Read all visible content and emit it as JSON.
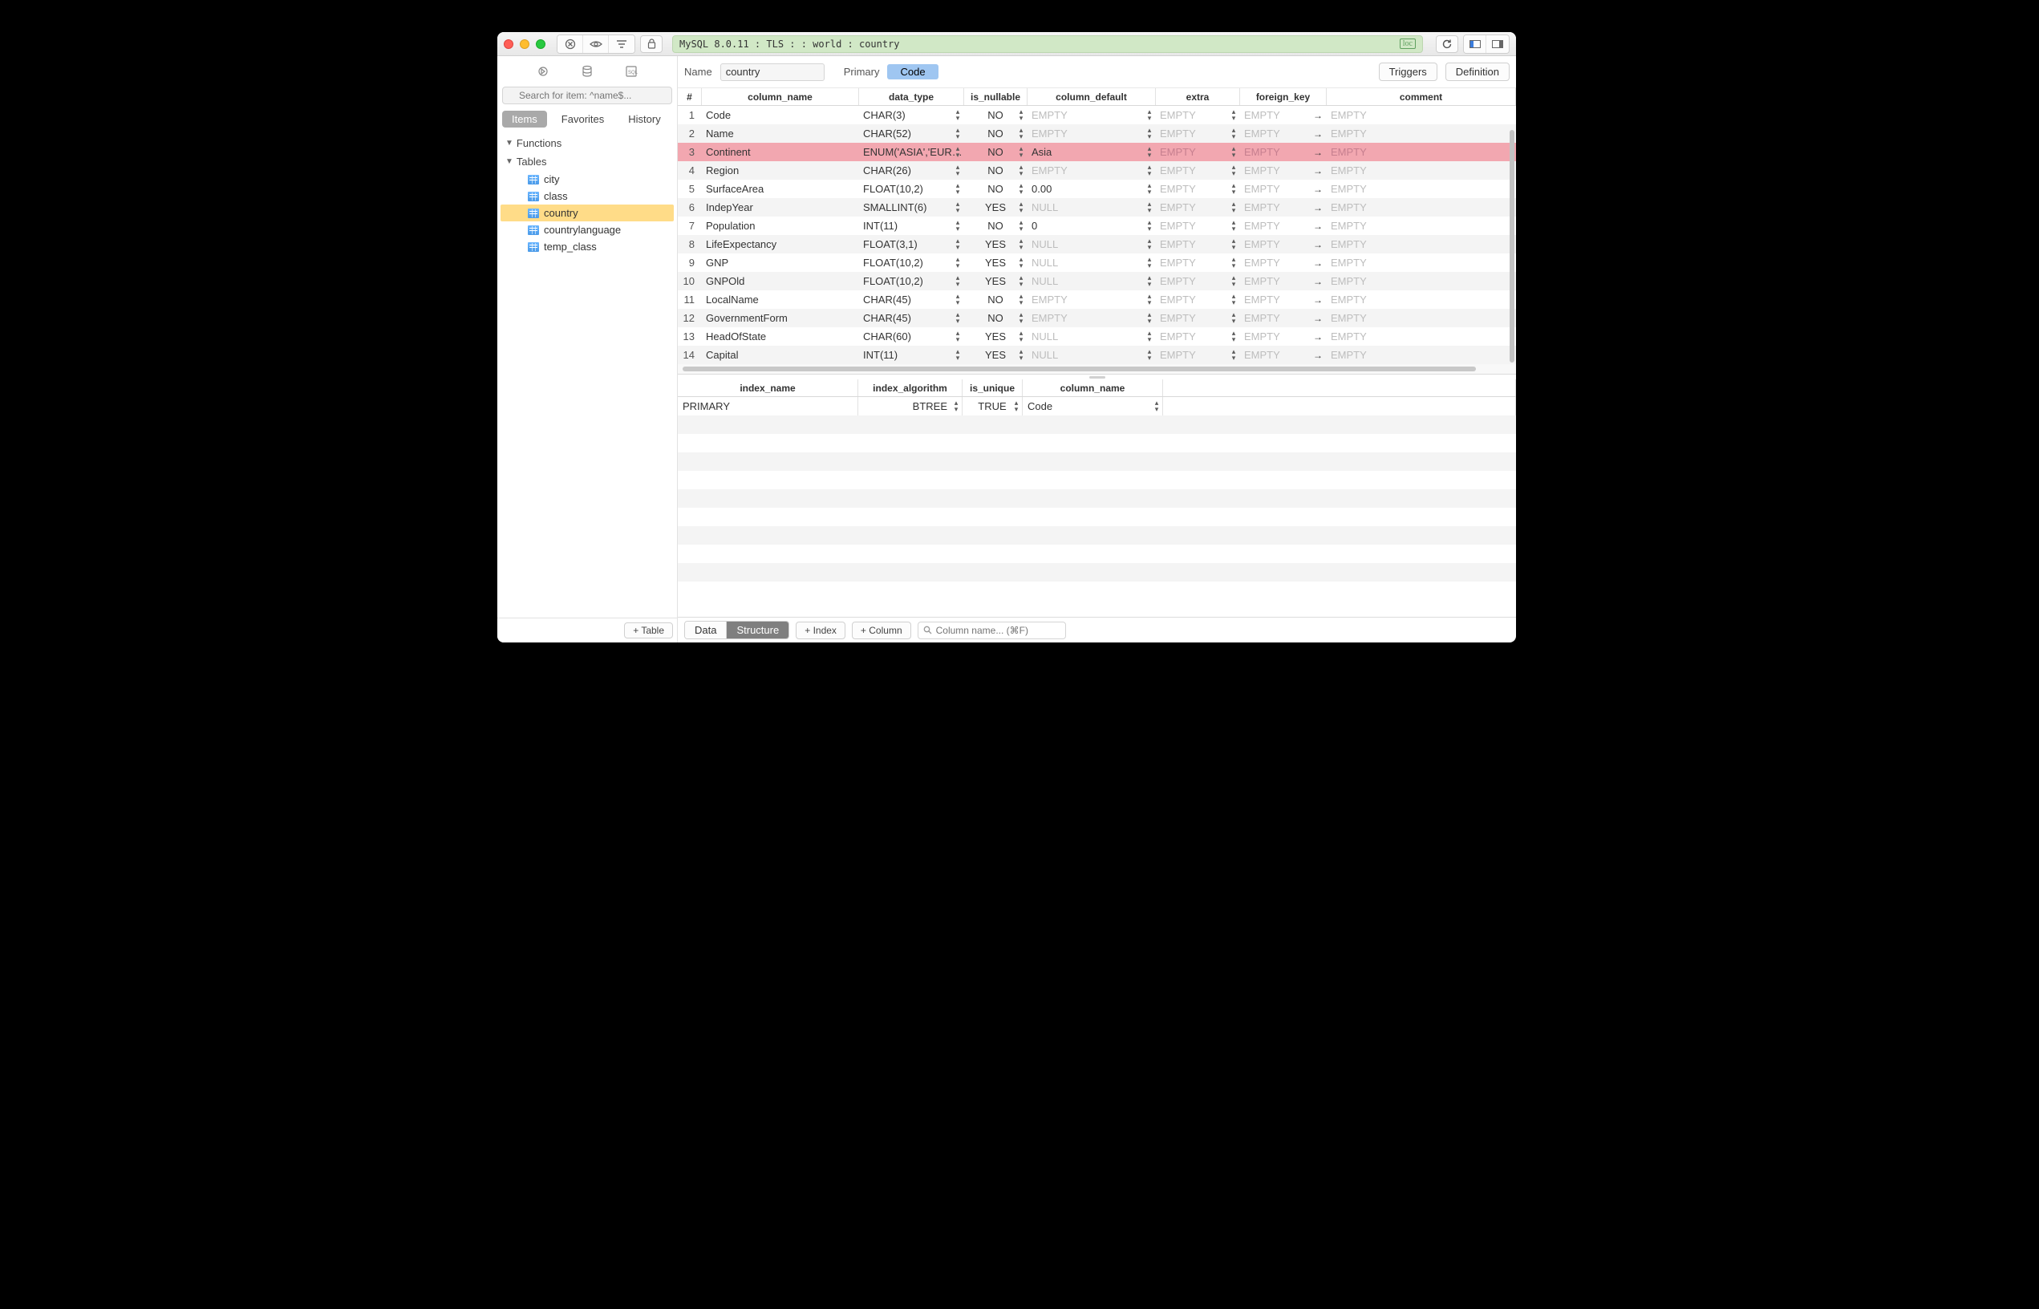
{
  "titlebar": {
    "connection_string": "MySQL 8.0.11 : TLS :  : world : country",
    "loc_badge": "loc"
  },
  "sidebar": {
    "search_placeholder": "Search for item: ^name$...",
    "tabs": [
      "Items",
      "Favorites",
      "History"
    ],
    "sections": [
      {
        "label": "Functions"
      },
      {
        "label": "Tables",
        "items": [
          "city",
          "class",
          "country",
          "countrylanguage",
          "temp_class"
        ],
        "selected": "country"
      }
    ],
    "add_table_label": "Table"
  },
  "main": {
    "name_label": "Name",
    "name_value": "country",
    "primary_label": "Primary",
    "primary_value": "Code",
    "triggers_btn": "Triggers",
    "definition_btn": "Definition",
    "column_headers": [
      "#",
      "column_name",
      "data_type",
      "is_nullable",
      "column_default",
      "extra",
      "foreign_key",
      "comment"
    ],
    "columns": [
      {
        "n": "1",
        "name": "Code",
        "type": "CHAR(3)",
        "nullable": "NO",
        "def": "EMPTY",
        "def_empty": true,
        "extra": "EMPTY",
        "fk": "EMPTY",
        "comment": "EMPTY"
      },
      {
        "n": "2",
        "name": "Name",
        "type": "CHAR(52)",
        "nullable": "NO",
        "def": "EMPTY",
        "def_empty": true,
        "extra": "EMPTY",
        "fk": "EMPTY",
        "comment": "EMPTY"
      },
      {
        "n": "3",
        "name": "Continent",
        "type": "ENUM('ASIA','EUR…",
        "nullable": "NO",
        "def": "Asia",
        "def_empty": false,
        "extra": "EMPTY",
        "fk": "EMPTY",
        "comment": "EMPTY",
        "selected": true
      },
      {
        "n": "4",
        "name": "Region",
        "type": "CHAR(26)",
        "nullable": "NO",
        "def": "EMPTY",
        "def_empty": true,
        "extra": "EMPTY",
        "fk": "EMPTY",
        "comment": "EMPTY"
      },
      {
        "n": "5",
        "name": "SurfaceArea",
        "type": "FLOAT(10,2)",
        "nullable": "NO",
        "def": "0.00",
        "def_empty": false,
        "extra": "EMPTY",
        "fk": "EMPTY",
        "comment": "EMPTY"
      },
      {
        "n": "6",
        "name": "IndepYear",
        "type": "SMALLINT(6)",
        "nullable": "YES",
        "def": "NULL",
        "def_empty": true,
        "extra": "EMPTY",
        "fk": "EMPTY",
        "comment": "EMPTY"
      },
      {
        "n": "7",
        "name": "Population",
        "type": "INT(11)",
        "nullable": "NO",
        "def": "0",
        "def_empty": false,
        "extra": "EMPTY",
        "fk": "EMPTY",
        "comment": "EMPTY"
      },
      {
        "n": "8",
        "name": "LifeExpectancy",
        "type": "FLOAT(3,1)",
        "nullable": "YES",
        "def": "NULL",
        "def_empty": true,
        "extra": "EMPTY",
        "fk": "EMPTY",
        "comment": "EMPTY"
      },
      {
        "n": "9",
        "name": "GNP",
        "type": "FLOAT(10,2)",
        "nullable": "YES",
        "def": "NULL",
        "def_empty": true,
        "extra": "EMPTY",
        "fk": "EMPTY",
        "comment": "EMPTY"
      },
      {
        "n": "10",
        "name": "GNPOld",
        "type": "FLOAT(10,2)",
        "nullable": "YES",
        "def": "NULL",
        "def_empty": true,
        "extra": "EMPTY",
        "fk": "EMPTY",
        "comment": "EMPTY"
      },
      {
        "n": "11",
        "name": "LocalName",
        "type": "CHAR(45)",
        "nullable": "NO",
        "def": "EMPTY",
        "def_empty": true,
        "extra": "EMPTY",
        "fk": "EMPTY",
        "comment": "EMPTY"
      },
      {
        "n": "12",
        "name": "GovernmentForm",
        "type": "CHAR(45)",
        "nullable": "NO",
        "def": "EMPTY",
        "def_empty": true,
        "extra": "EMPTY",
        "fk": "EMPTY",
        "comment": "EMPTY"
      },
      {
        "n": "13",
        "name": "HeadOfState",
        "type": "CHAR(60)",
        "nullable": "YES",
        "def": "NULL",
        "def_empty": true,
        "extra": "EMPTY",
        "fk": "EMPTY",
        "comment": "EMPTY"
      },
      {
        "n": "14",
        "name": "Capital",
        "type": "INT(11)",
        "nullable": "YES",
        "def": "NULL",
        "def_empty": true,
        "extra": "EMPTY",
        "fk": "EMPTY",
        "comment": "EMPTY"
      }
    ],
    "index_headers": [
      "index_name",
      "index_algorithm",
      "is_unique",
      "column_name"
    ],
    "indexes": [
      {
        "name": "PRIMARY",
        "algo": "BTREE",
        "unique": "TRUE",
        "col": "Code"
      }
    ]
  },
  "footer": {
    "seg": [
      "Data",
      "Structure"
    ],
    "add_index": "Index",
    "add_column": "Column",
    "search_placeholder": "Column name... (⌘F)"
  }
}
